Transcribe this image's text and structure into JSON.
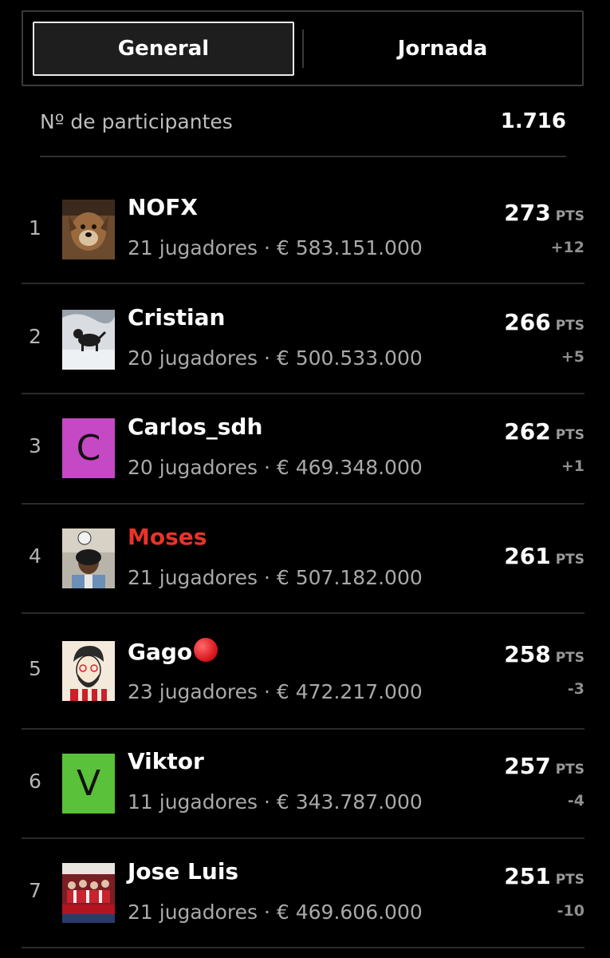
{
  "tabs": {
    "general": "General",
    "jornada": "Jornada"
  },
  "participants": {
    "label": "Nº de participantes",
    "value": "1.716"
  },
  "pts_unit": "PTS",
  "rows": [
    {
      "rank": "1",
      "name": "NOFX",
      "meta": "21 jugadores · € 583.151.000",
      "points": "273",
      "delta": "+12",
      "avatar": "dog-photo"
    },
    {
      "rank": "2",
      "name": "Cristian",
      "meta": "20 jugadores · € 500.533.000",
      "points": "266",
      "delta": "+5",
      "avatar": "dog-in-snow-photo"
    },
    {
      "rank": "3",
      "name": "Carlos_sdh",
      "meta": "20 jugadores · € 469.348.000",
      "points": "262",
      "delta": "+1",
      "avatar_letter": "C",
      "avatar_color": "#c548c4"
    },
    {
      "rank": "4",
      "name": "Moses",
      "meta": "21 jugadores · € 507.182.000",
      "points": "261",
      "delta": "",
      "avatar": "footballer-photo",
      "highlight_color": "#e8332a"
    },
    {
      "rank": "5",
      "name": "Gago",
      "meta": "23 jugadores · € 472.217.000",
      "points": "258",
      "delta": "-3",
      "avatar": "cartoon-man-illustration",
      "badge": "red-circle-emoji"
    },
    {
      "rank": "6",
      "name": "Viktor",
      "meta": "11 jugadores · € 343.787.000",
      "points": "257",
      "delta": "-4",
      "avatar_letter": "V",
      "avatar_color": "#5ac13a"
    },
    {
      "rank": "7",
      "name": "Jose Luis",
      "meta": "21 jugadores · € 469.606.000",
      "points": "251",
      "delta": "-10",
      "avatar": "campeones-team-photo"
    }
  ]
}
